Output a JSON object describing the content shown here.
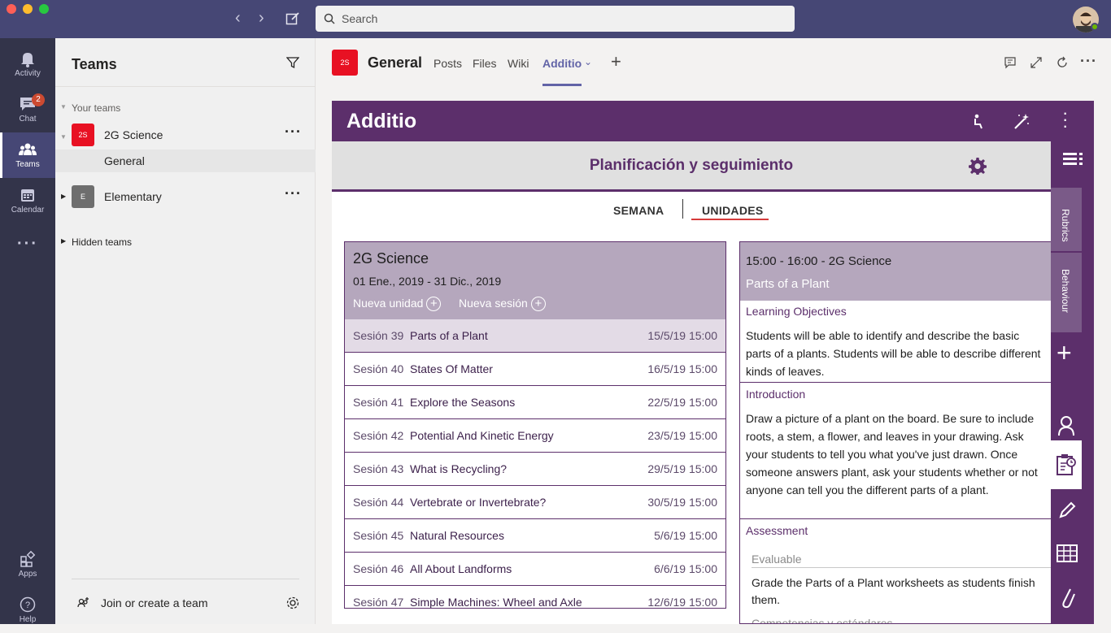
{
  "titlebar": {
    "search_placeholder": "Search"
  },
  "rail": {
    "items": [
      {
        "label": "Activity"
      },
      {
        "label": "Chat",
        "badge": "2"
      },
      {
        "label": "Teams"
      },
      {
        "label": "Calendar"
      },
      {
        "label": "Apps"
      },
      {
        "label": "Help"
      }
    ]
  },
  "teams_panel": {
    "title": "Teams",
    "your_teams": "Your teams",
    "teams": [
      {
        "initials": "2S",
        "name": "2G Science",
        "color": "#e81123"
      },
      {
        "initials": "E",
        "name": "Elementary",
        "color": "#6e6e6e"
      }
    ],
    "channel": "General",
    "hidden": "Hidden teams",
    "join": "Join or create a team"
  },
  "channel_header": {
    "initials": "2S",
    "title": "General",
    "tabs": [
      "Posts",
      "Files",
      "Wiki",
      "Additio"
    ]
  },
  "app": {
    "logo": "Additio",
    "plan_title": "Planificación y seguimiento",
    "segments": [
      "SEMANA",
      "UNIDADES"
    ],
    "unit": {
      "title": "2G Science",
      "dates": "01 Ene., 2019 - 31 Dic., 2019",
      "new_unit": "Nueva unidad",
      "new_session": "Nueva sesión"
    },
    "sessions": [
      {
        "num": "Sesión 39",
        "name": "Parts of a Plant",
        "date": "15/5/19 15:00"
      },
      {
        "num": "Sesión 40",
        "name": "States Of Matter",
        "date": "16/5/19 15:00"
      },
      {
        "num": "Sesión 41",
        "name": "Explore the Seasons",
        "date": "22/5/19 15:00"
      },
      {
        "num": "Sesión 42",
        "name": "Potential And Kinetic Energy",
        "date": "23/5/19 15:00"
      },
      {
        "num": "Sesión 43",
        "name": "What is Recycling?",
        "date": "29/5/19 15:00"
      },
      {
        "num": "Sesión 44",
        "name": "Vertebrate or Invertebrate?",
        "date": "30/5/19 15:00"
      },
      {
        "num": "Sesión 45",
        "name": "Natural Resources",
        "date": "5/6/19 15:00"
      },
      {
        "num": "Sesión 46",
        "name": "All About Landforms",
        "date": "6/6/19 15:00"
      },
      {
        "num": "Sesión 47",
        "name": "Simple Machines: Wheel and Axle",
        "date": "12/6/19 15:00"
      }
    ],
    "detail": {
      "time": "15:00 - 16:00  -  2G Science",
      "name": "Parts of a Plant",
      "objectives_label": "Learning Objectives",
      "objectives_text": "Students will be able to identify and describe the basic parts of a plants. Students will be able to describe different kinds of leaves.",
      "intro_label": "Introduction",
      "intro_text": "Draw a picture of a plant on the board. Be sure to include roots, a stem, a flower, and leaves in your drawing. Ask your students to tell you what you've just drawn. Once someone answers plant, ask your students whether or not anyone can tell you the different parts of a plant.",
      "assessment_label": "Assessment",
      "evaluable": "Evaluable",
      "assessment_text": "Grade the Parts of a Plant worksheets as students finish them.",
      "cut_label": "Competencias y estándares"
    },
    "side_tabs": [
      "Rubrics",
      "Behaviour"
    ]
  }
}
